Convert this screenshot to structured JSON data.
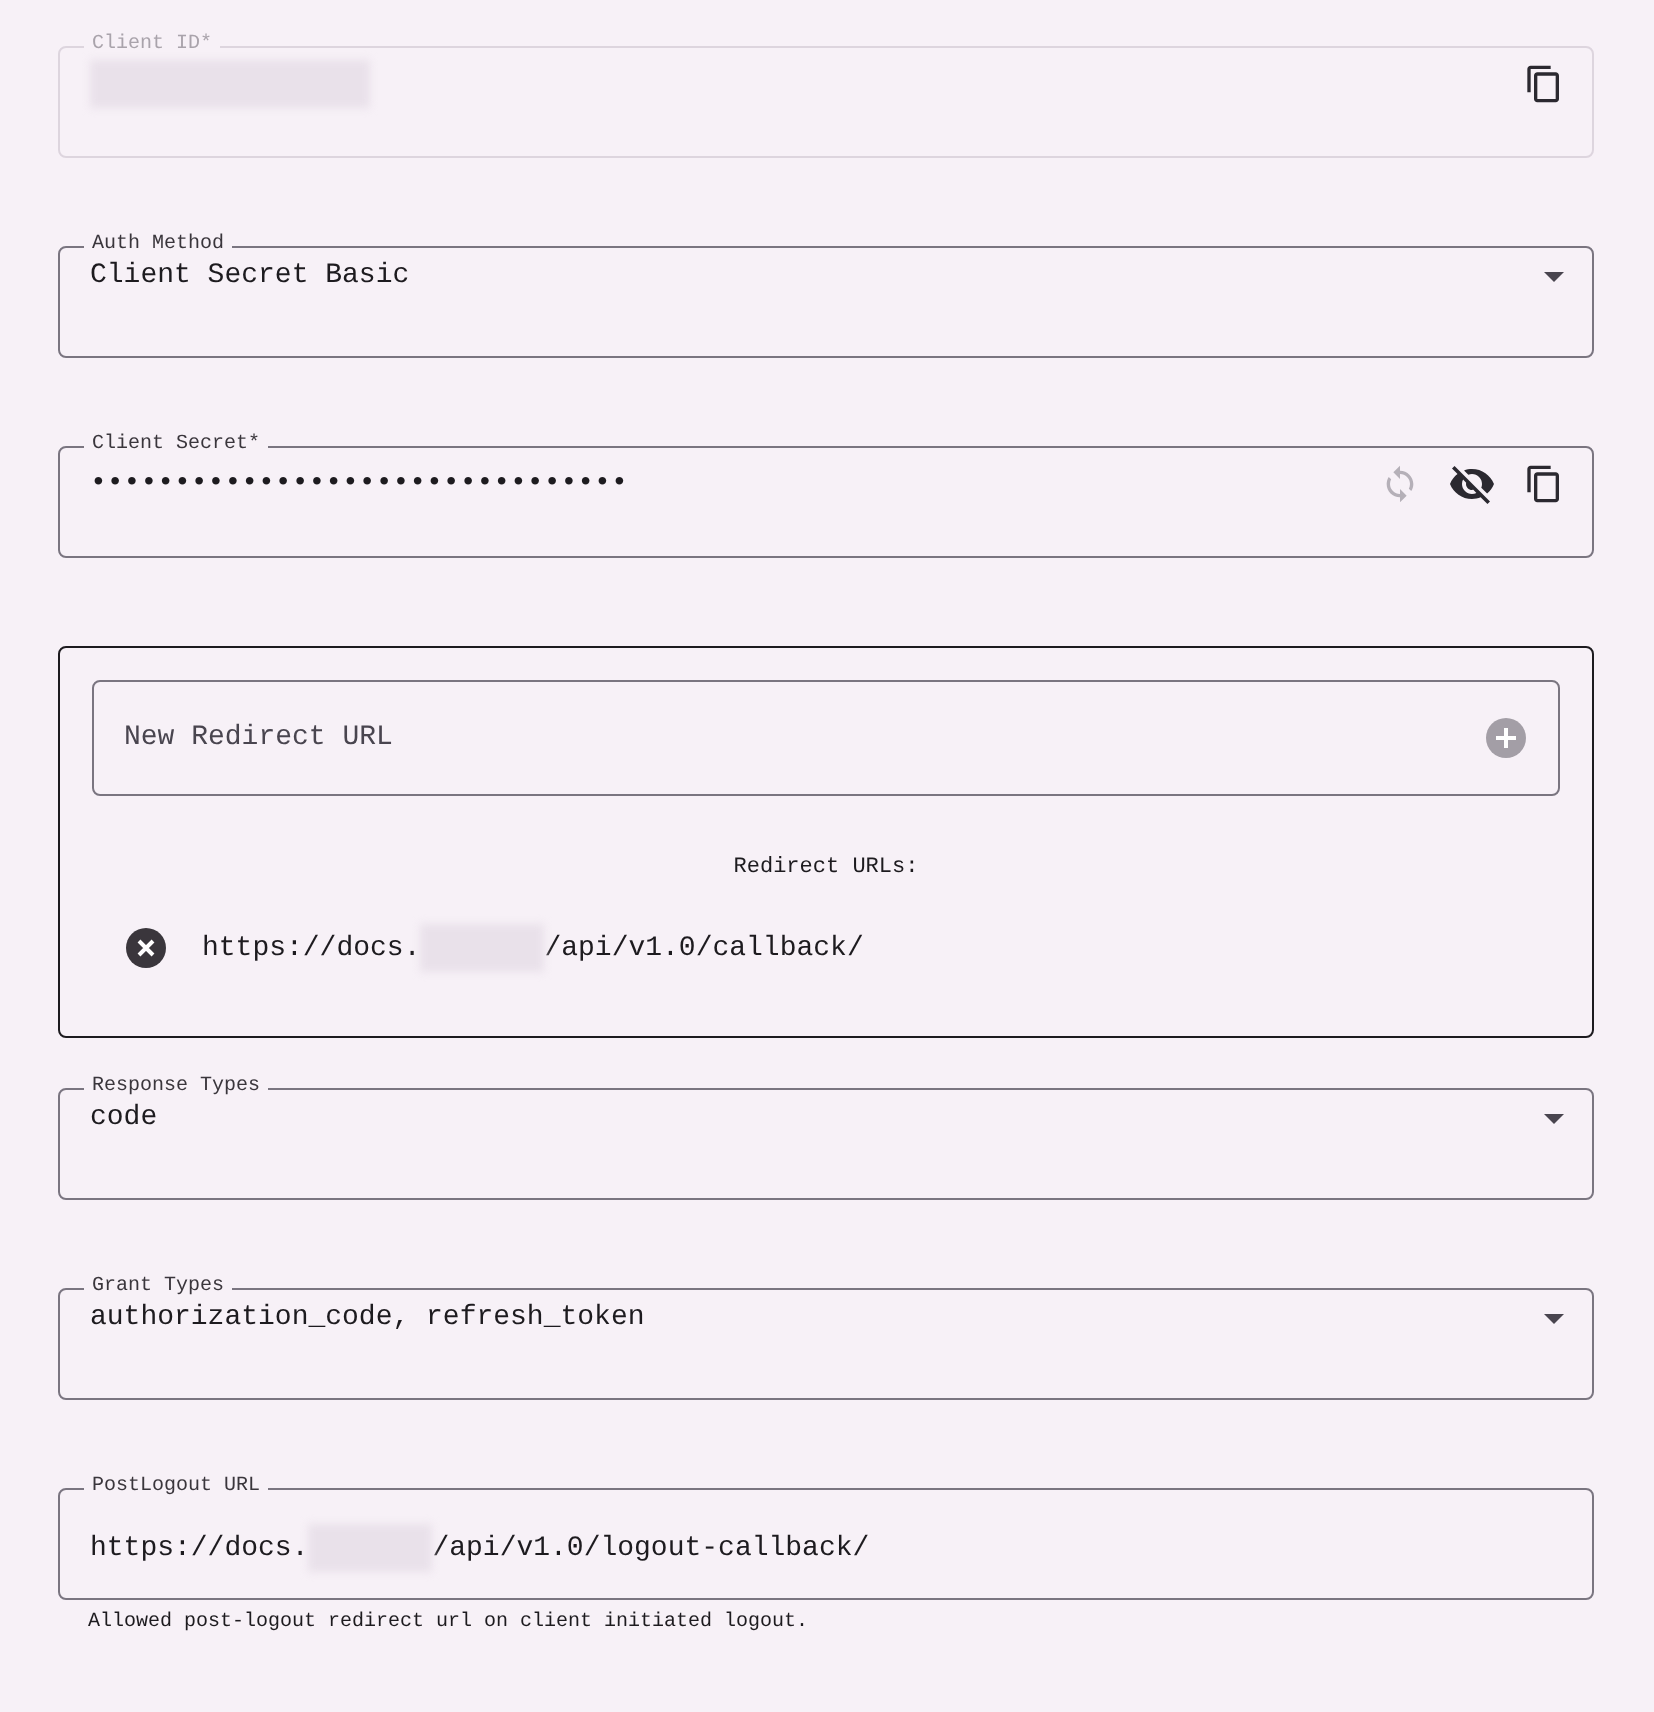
{
  "client_id": {
    "label": "Client ID*",
    "disabled": true,
    "redacted": true
  },
  "auth_method": {
    "label": "Auth Method",
    "value": "Client Secret Basic"
  },
  "client_secret": {
    "label": "Client Secret*",
    "value": "••••••••••••••••••••••••••••••••",
    "regenerate_disabled": true
  },
  "redirects": {
    "new_placeholder": "New Redirect URL",
    "heading": "Redirect URLs:",
    "urls": [
      {
        "prefix": "https://docs.",
        "suffix": "/api/v1.0/callback/"
      }
    ]
  },
  "response_types": {
    "label": "Response Types",
    "value": "code"
  },
  "grant_types": {
    "label": "Grant Types",
    "value": "authorization_code, refresh_token"
  },
  "post_logout": {
    "label": "PostLogout URL",
    "prefix": "https://docs.",
    "suffix": "/api/v1.0/logout-callback/",
    "helper": "Allowed post-logout redirect url on client initiated logout."
  }
}
